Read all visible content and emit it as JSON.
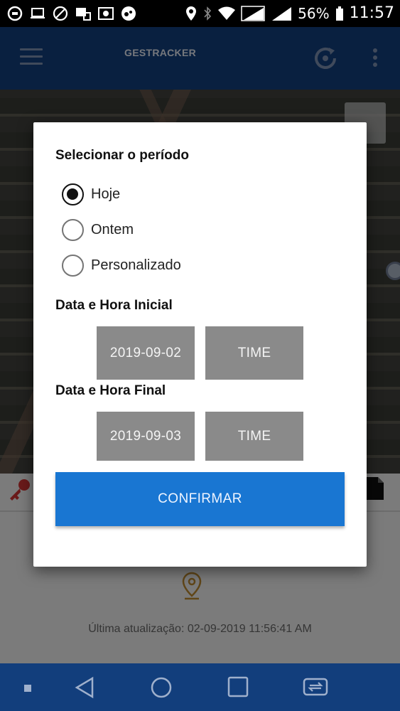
{
  "status_bar": {
    "battery": "56%",
    "time": "11:57"
  },
  "app_bar": {
    "title": "GESTRACKER",
    "menu_icon": "hamburger-icon",
    "refresh_icon": "refresh-icon",
    "more_icon": "more-vert-icon"
  },
  "background": {
    "last_update": "Última atualização: 02-09-2019 11:56:41 AM"
  },
  "dialog": {
    "title": "Selecionar o período",
    "options": [
      {
        "label": "Hoje",
        "checked": true
      },
      {
        "label": "Ontem",
        "checked": false
      },
      {
        "label": "Personalizado",
        "checked": false
      }
    ],
    "start": {
      "heading": "Data e Hora Inicial",
      "date": "2019-09-02",
      "time": "TIME"
    },
    "end": {
      "heading": "Data e Hora Final",
      "date": "2019-09-03",
      "time": "TIME"
    },
    "confirm_label": "CONFIRMAR"
  },
  "colors": {
    "app_bar": "#123e7c",
    "confirm": "#1976d2",
    "button_gray": "#8a8a8a"
  }
}
